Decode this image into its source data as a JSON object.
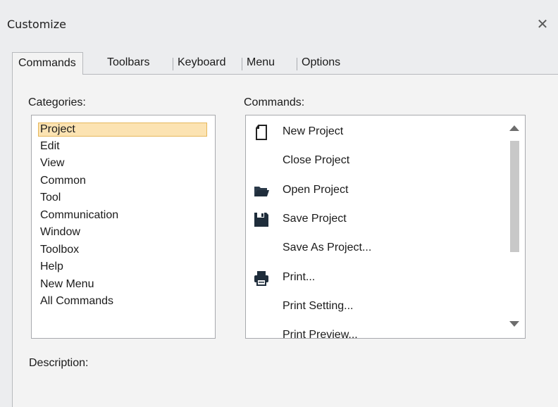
{
  "window": {
    "title": "Customize",
    "close_glyph": "✕"
  },
  "tabs": [
    {
      "label": "Commands",
      "active": true
    },
    {
      "label": "Toolbars",
      "active": false
    },
    {
      "label": "Keyboard",
      "active": false
    },
    {
      "label": "Menu",
      "active": false
    },
    {
      "label": "Options",
      "active": false
    }
  ],
  "categories": {
    "label": "Categories:",
    "items": [
      "Project",
      "Edit",
      "View",
      "Common",
      "Tool",
      "Communication",
      "Window",
      "Toolbox",
      "Help",
      "New Menu",
      "All Commands"
    ],
    "selected": "Project"
  },
  "commands": {
    "label": "Commands:",
    "items": [
      {
        "label": "New Project",
        "icon": "new-document-icon"
      },
      {
        "label": "Close Project",
        "icon": ""
      },
      {
        "label": "Open Project",
        "icon": "open-folder-icon"
      },
      {
        "label": "Save Project",
        "icon": "floppy-disk-icon"
      },
      {
        "label": "Save As Project...",
        "icon": ""
      },
      {
        "label": "Print...",
        "icon": "printer-icon"
      },
      {
        "label": "Print Setting...",
        "icon": ""
      },
      {
        "label": "Print Preview...",
        "icon": ""
      }
    ]
  },
  "description": {
    "label": "Description:"
  }
}
